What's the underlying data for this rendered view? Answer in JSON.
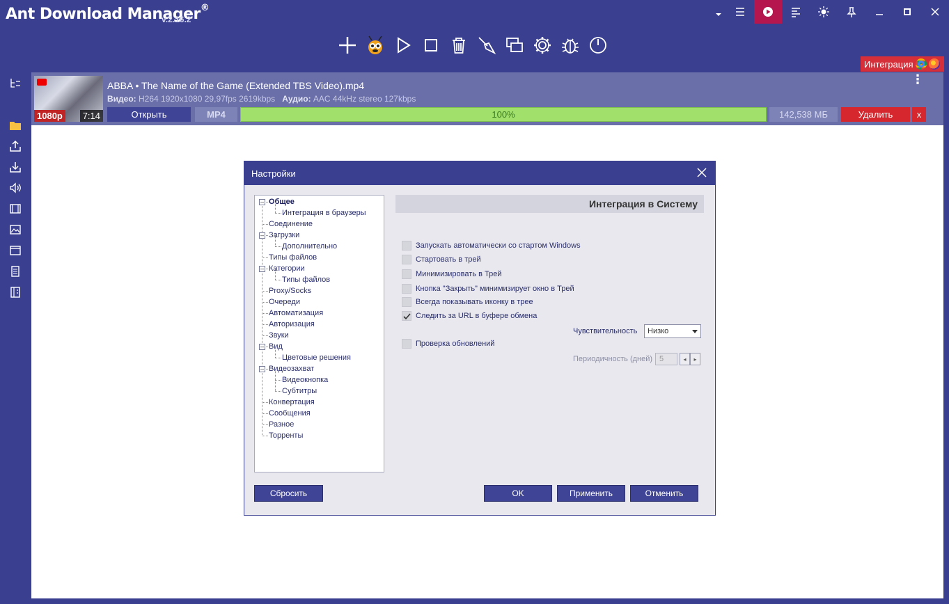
{
  "app": {
    "title": "Ant Download Manager",
    "reg_mark": "®",
    "version": "v.2.16.2"
  },
  "integration_badge": {
    "label": "Интеграция"
  },
  "download": {
    "name": "ABBA • The Name of the Game (Extended TBS Video).mp4",
    "video_label": "Видео:",
    "video_info": "H264 1920x1080 29,97fps 2619kbps",
    "audio_label": "Аудио:",
    "audio_info": "AAC 44kHz stereo 127kbps",
    "quality": "1080p",
    "duration": "7:14",
    "open_label": "Открыть",
    "format": "MP4",
    "progress_text": "100%",
    "progress_fraction": 1.0,
    "size": "142,538 МБ",
    "delete_label": "Удалить",
    "close_label": "x",
    "menu_glyph": "⋮"
  },
  "dialog": {
    "title": "Настройки",
    "section_title": "Интеграция в Систему",
    "tree": [
      "Общее",
      "Интеграция в браузеры",
      "Соединение",
      "Загрузки",
      "Дополнительно",
      "Типы файлов",
      "Категории",
      "Типы файлов",
      "Proxy/Socks",
      "Очереди",
      "Автоматизация",
      "Авторизация",
      "Звуки",
      "Вид",
      "Цветовые решения",
      "Видеозахват",
      "Видеокнопка",
      "Субтитры",
      "Конвертация",
      "Сообщения",
      "Разное",
      "Торренты"
    ],
    "options": [
      {
        "label": "Запускать автоматически со стартом Windows",
        "checked": false
      },
      {
        "label": "Стартовать в трей",
        "checked": false
      },
      {
        "label": "Минимизировать в Трей",
        "checked": false
      },
      {
        "label": "Кнопка \"Закрыть\" минимизирует окно в Трей",
        "checked": false
      },
      {
        "label": "Всегда показывать иконку в трее",
        "checked": false
      },
      {
        "label": "Следить за URL в буфере обмена",
        "checked": true
      },
      {
        "label": "Проверка обновлений",
        "checked": false
      }
    ],
    "sensitivity_label": "Чувствительность",
    "sensitivity_value": "Низко",
    "period_label": "Периодичность (дней)",
    "period_value": "5",
    "reset_label": "Сбросить",
    "ok_label": "OK",
    "apply_label": "Применить",
    "cancel_label": "Отменить"
  },
  "colors": {
    "frame": "#3a3f8f",
    "row": "#6a6fa9",
    "progress": "#a1e06b",
    "delete": "#d6262e",
    "record": "#b5164e"
  }
}
